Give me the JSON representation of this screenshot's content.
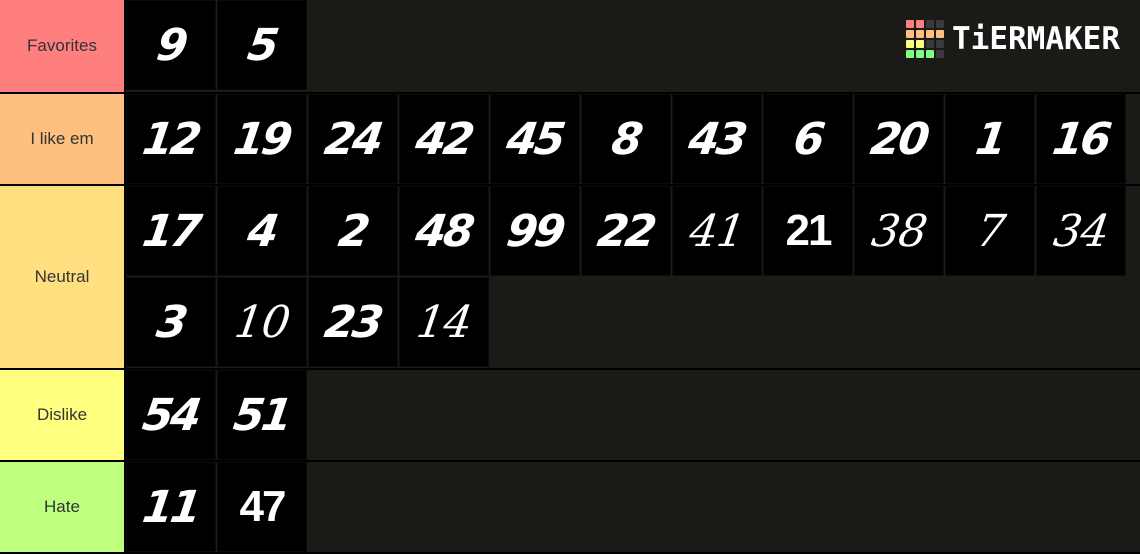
{
  "logo": {
    "text": "TiERMAKER",
    "grid_colors": [
      "#ff7f7f",
      "#ff7f7f",
      "#3a3a3a",
      "#3a3a3a",
      "#ffbf7f",
      "#ffbf7f",
      "#ffbf7f",
      "#ffbf7f",
      "#ffff7f",
      "#ffff7f",
      "#3a3a3a",
      "#3a3a3a",
      "#7fff7f",
      "#7fff7f",
      "#7fff7f",
      "#3a3a3a"
    ]
  },
  "tiers": [
    {
      "label": "Favorites",
      "color": "#ff7f7f",
      "items": [
        "9",
        "5"
      ]
    },
    {
      "label": "I like em",
      "color": "#ffbf7f",
      "items": [
        "12",
        "19",
        "24",
        "42",
        "45",
        "8",
        "43",
        "6",
        "20",
        "1",
        "16"
      ]
    },
    {
      "label": "Neutral",
      "color": "#ffdf7f",
      "items": [
        "17",
        "4",
        "2",
        "48",
        "99",
        "22",
        "41",
        "21",
        "38",
        "7",
        "34",
        "3",
        "10",
        "23",
        "14"
      ]
    },
    {
      "label": "Dislike",
      "color": "#ffff7f",
      "items": [
        "54",
        "51"
      ]
    },
    {
      "label": "Hate",
      "color": "#bfff7f",
      "items": [
        "11",
        "47"
      ]
    }
  ]
}
